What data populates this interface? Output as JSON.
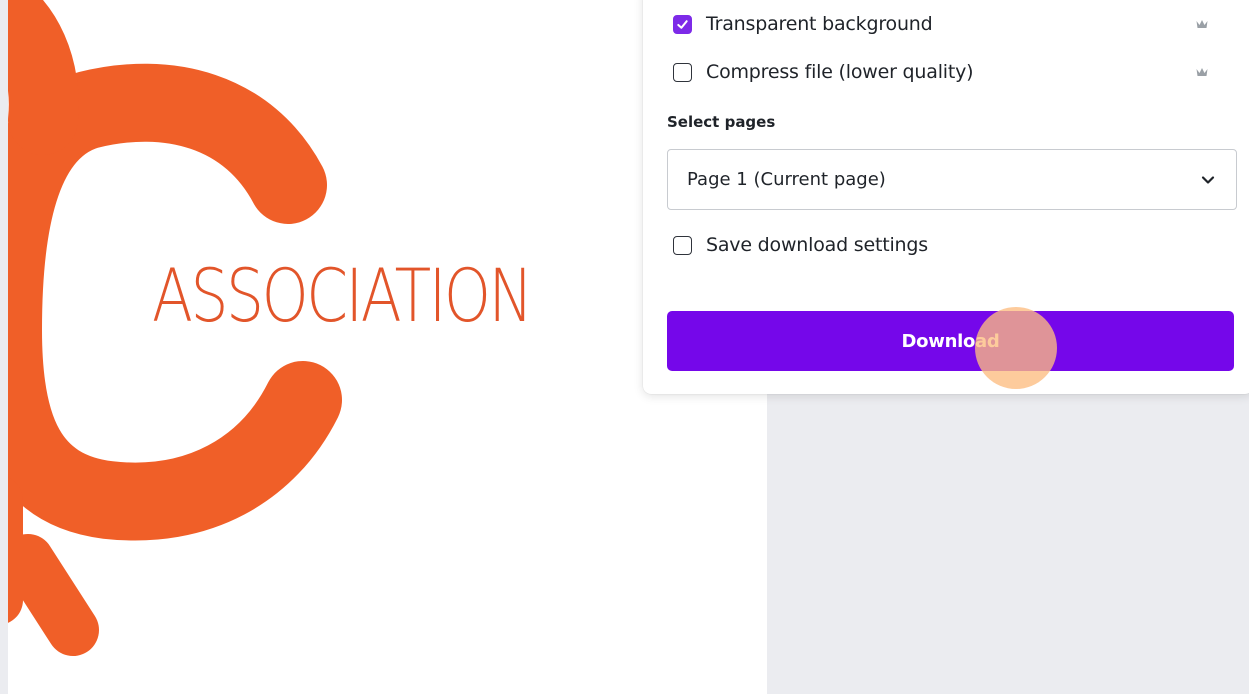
{
  "canvas": {
    "logo_text": "ASSOCIATION",
    "brand_color": "#e2552a"
  },
  "download_panel": {
    "options": [
      {
        "label": "Transparent background",
        "checked": true,
        "premium_icon": "crown-icon"
      },
      {
        "label": "Compress file (lower quality)",
        "checked": false,
        "premium_icon": "crown-icon"
      }
    ],
    "select_pages_label": "Select pages",
    "select_pages_value": "Page 1 (Current page)",
    "save_settings_label": "Save download settings",
    "save_settings_checked": false,
    "download_label": "Download",
    "accent_color": "#7d2ae8",
    "button_color": "#7507ea"
  }
}
